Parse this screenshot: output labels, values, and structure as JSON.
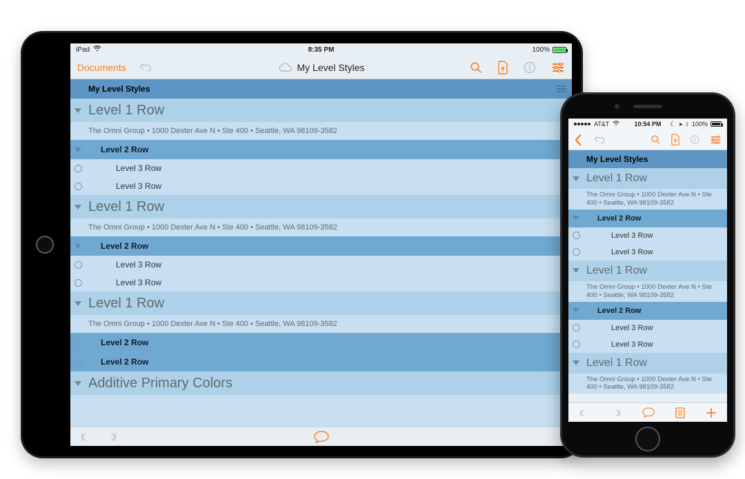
{
  "ipad": {
    "status": {
      "left": "iPad",
      "time": "8:35 PM",
      "battery": "100%"
    },
    "toolbar": {
      "documents": "Documents",
      "title": "My Level Styles"
    },
    "doc": {
      "header": "My Level Styles",
      "level1": "Level 1 Row",
      "note": "The Omni Group • 1000 Dexter Ave N • Ste 400 • Seattle, WA 98109-3582",
      "level2": "Level 2 Row",
      "level3a": "Level 3 Row",
      "level3b": "Level 3 Row",
      "additive": "Additive Primary Colors"
    }
  },
  "iphone": {
    "status": {
      "carrier": "AT&T",
      "time": "10:54 PM",
      "battery": "100%"
    },
    "doc": {
      "header": "My Level Styles",
      "level1": "Level 1 Row",
      "note": "The Omni Group • 1000 Dexter Ave N • Ste 400 • Seattle, WA 98109-3582",
      "level2": "Level 2 Row",
      "level3a": "Level 3 Row",
      "level3b": "Level 3 Row"
    }
  }
}
